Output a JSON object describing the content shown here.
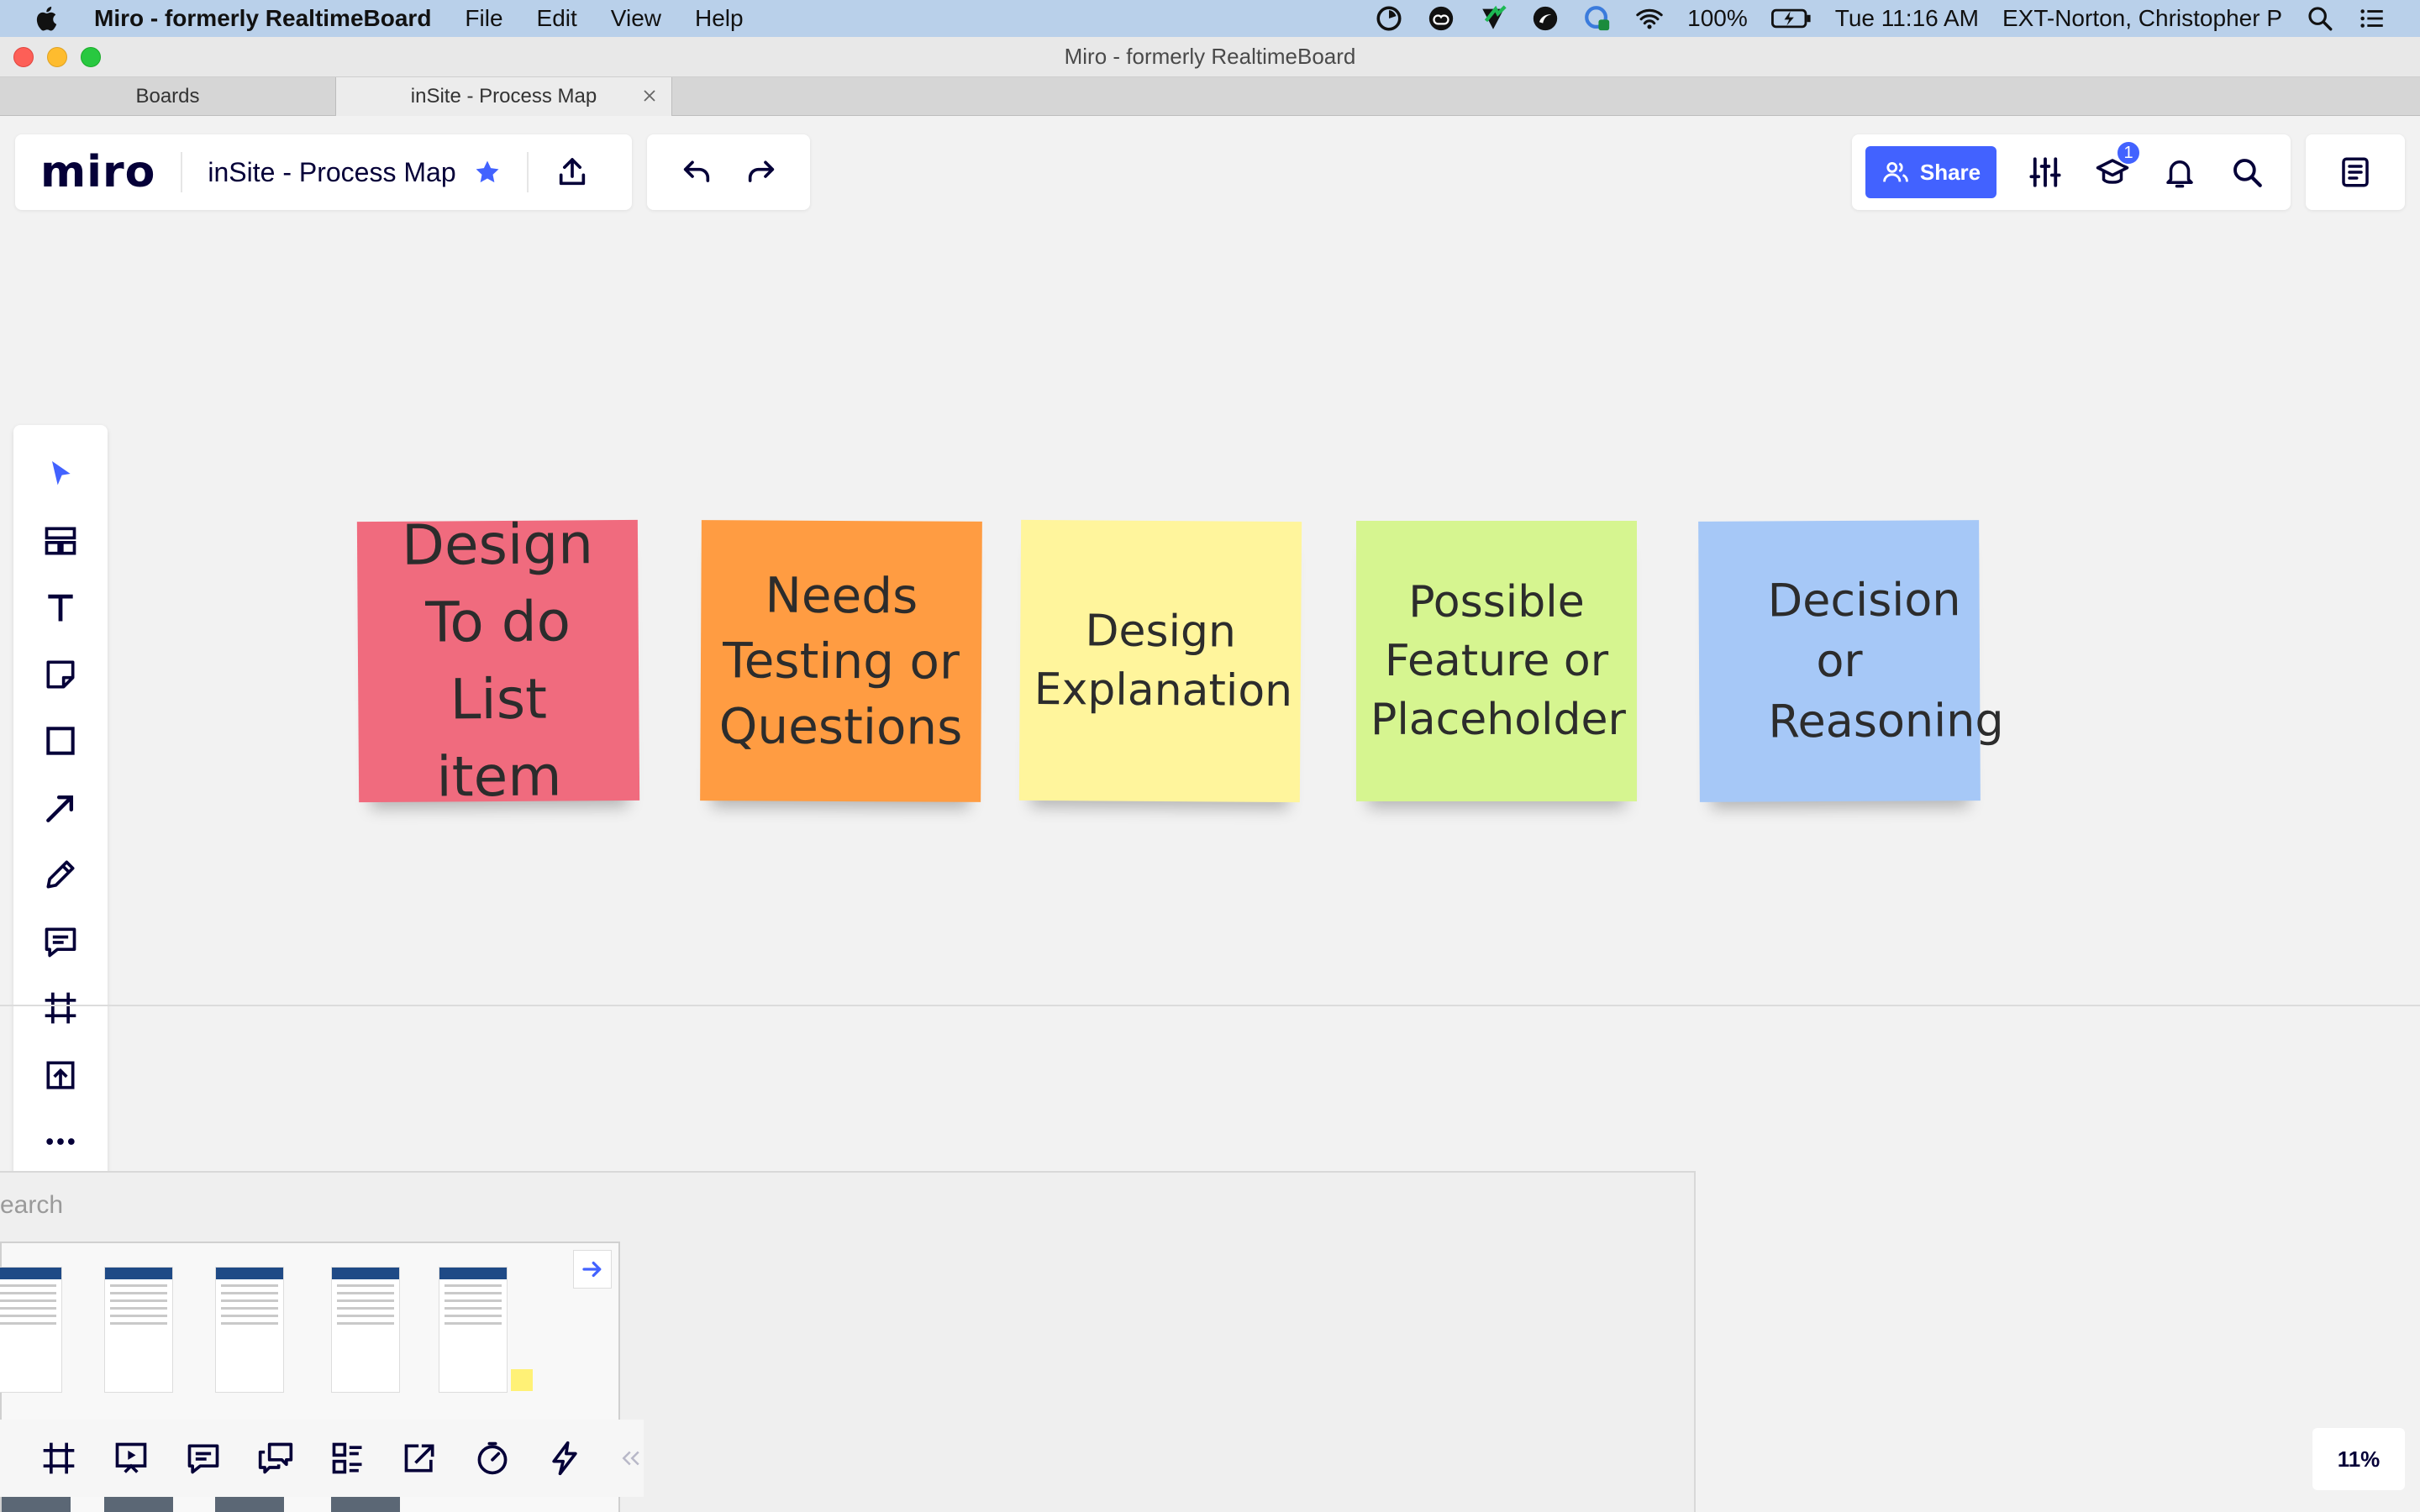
{
  "menubar": {
    "app_name": "Miro - formerly RealtimeBoard",
    "menus": [
      "File",
      "Edit",
      "View",
      "Help"
    ],
    "battery": "100%",
    "clock": "Tue 11:16 AM",
    "user": "EXT-Norton, Christopher P"
  },
  "window": {
    "title": "Miro - formerly RealtimeBoard"
  },
  "tabs": [
    {
      "label": "Boards",
      "active": false
    },
    {
      "label": "inSite - Process Map",
      "active": true
    }
  ],
  "board": {
    "logo": "miro",
    "title": "inSite - Process Map",
    "share_label": "Share",
    "notification_count": "1",
    "zoom": "11%"
  },
  "stickies": [
    {
      "text": "Design To do List item",
      "color": "#f06b7e"
    },
    {
      "text": "Needs Testing or Questions",
      "color": "#ff9c42"
    },
    {
      "text": "Design Explanation",
      "color": "#fff59c"
    },
    {
      "text": "Possible Feature or Placeholder",
      "color": "#d6f590"
    },
    {
      "text": "Decision or Reasoning",
      "color": "#a6c8f7"
    }
  ],
  "frame": {
    "label": "earch"
  },
  "colors": {
    "accent": "#4262ff",
    "menubar": "#b9d0ea"
  },
  "icons": {
    "toolbar": [
      "select-cursor-icon",
      "templates-icon",
      "text-icon",
      "sticky-note-icon",
      "shape-icon",
      "connection-line-icon",
      "pen-icon",
      "comment-icon",
      "frame-icon",
      "upload-icon",
      "more-icon"
    ],
    "bottom": [
      "frames-icon",
      "presentation-icon",
      "comments-icon",
      "chat-icon",
      "cards-icon",
      "screen-share-icon",
      "timer-icon",
      "lightning-icon",
      "collapse-icon"
    ]
  }
}
